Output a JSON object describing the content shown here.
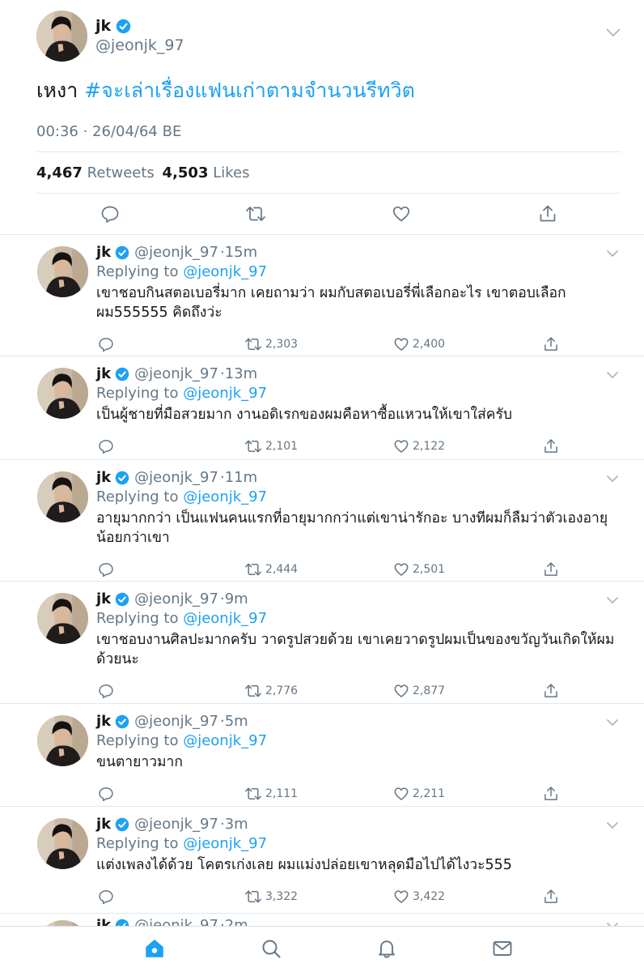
{
  "colors": {
    "accent": "#1da1f2",
    "text": "#14171a",
    "muted": "#657786",
    "divider": "#e1e8ed"
  },
  "main_tweet": {
    "name": "jk",
    "handle": "@jeonjk_97",
    "text_plain": "เหงา ",
    "hashtag": "#จะเล่าเรื่องแฟนเก่าตามจำนวนรีทวิต",
    "timestamp": "00:36 · 26/04/64 BE",
    "retweets_count": "4,467",
    "retweets_label": "Retweets",
    "likes_count": "4,503",
    "likes_label": "Likes",
    "actions": [
      "reply-icon",
      "retweet-icon",
      "like-icon",
      "share-icon"
    ]
  },
  "replies": [
    {
      "name": "jk",
      "handle": "@jeonjk_97",
      "time": "15m",
      "replying_label": "Replying to",
      "replying_to": "@jeonjk_97",
      "text": "เขาชอบกินสตอเบอรี่มาก เคยถามว่า ผมกับสตอเบอรี่พี่เลือกอะไร เขาตอบเลือกผม555555 คิดถึงว่ะ",
      "retweets": "2,303",
      "likes": "2,400"
    },
    {
      "name": "jk",
      "handle": "@jeonjk_97",
      "time": "13m",
      "replying_label": "Replying to",
      "replying_to": "@jeonjk_97",
      "text": "เป็นผู้ชายที่มือสวยมาก งานอดิเรกของผมคือหาซื้อแหวนให้เขาใส่ครับ",
      "retweets": "2,101",
      "likes": "2,122"
    },
    {
      "name": "jk",
      "handle": "@jeonjk_97",
      "time": "11m",
      "replying_label": "Replying to",
      "replying_to": "@jeonjk_97",
      "text": "อายุมากกว่า เป็นแฟนคนแรกที่อายุมากกว่าแต่เขาน่ารักอะ บางทีผมก็ลืมว่าตัวเองอายุน้อยกว่าเขา",
      "retweets": "2,444",
      "likes": "2,501"
    },
    {
      "name": "jk",
      "handle": "@jeonjk_97",
      "time": "9m",
      "replying_label": "Replying to",
      "replying_to": "@jeonjk_97",
      "text": "เขาชอบงานศิลปะมากครับ วาดรูปสวยด้วย เขาเคยวาดรูปผมเป็นของขวัญวันเกิดให้ผมด้วยนะ",
      "retweets": "2,776",
      "likes": "2,877"
    },
    {
      "name": "jk",
      "handle": "@jeonjk_97",
      "time": "5m",
      "replying_label": "Replying to",
      "replying_to": "@jeonjk_97",
      "text": "ขนตายาวมาก",
      "retweets": "2,111",
      "likes": "2,211"
    },
    {
      "name": "jk",
      "handle": "@jeonjk_97",
      "time": "3m",
      "replying_label": "Replying to",
      "replying_to": "@jeonjk_97",
      "text": "แต่งเพลงได้ด้วย โคตรเก่งเลย ผมแม่งปล่อยเขาหลุดมือไปได้ไงวะ555",
      "retweets": "3,322",
      "likes": "3,422"
    }
  ],
  "partial_reply": {
    "name": "jk",
    "handle": "@jeonjk_97",
    "time": "2m"
  },
  "tabbar": {
    "tabs": [
      "home-icon",
      "search-icon",
      "notifications-icon",
      "messages-icon"
    ],
    "active": "home-icon"
  }
}
